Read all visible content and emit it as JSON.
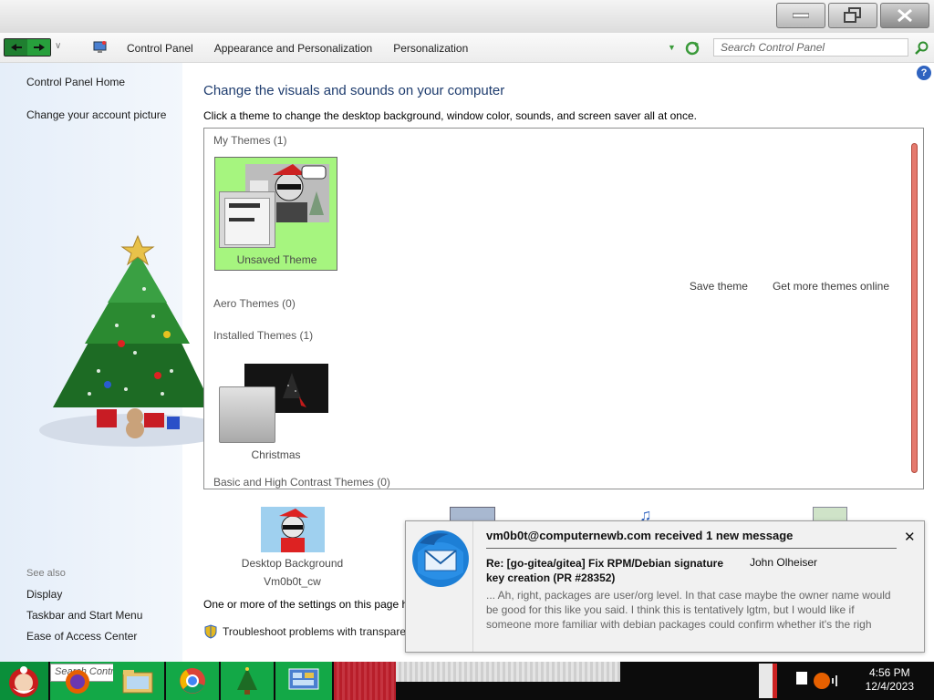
{
  "window": {
    "buttons": {
      "minimize": "minimize",
      "restore": "restore",
      "close": "close"
    }
  },
  "nav": {
    "breadcrumbs": [
      "Control Panel",
      "Appearance and Personalization",
      "Personalization"
    ],
    "search_placeholder": "Search Control Panel"
  },
  "sidebar": {
    "links": [
      "Control Panel Home",
      "Change your account picture"
    ],
    "see_also_heading": "See also",
    "see_also_links": [
      "Display",
      "Taskbar and Start Menu",
      "Ease of Access Center"
    ]
  },
  "main": {
    "title": "Change the visuals and sounds on your computer",
    "subtitle": "Click a theme to change the desktop background, window color, sounds, and screen saver all at once.",
    "groups": {
      "my_themes": "My Themes (1)",
      "aero_themes": "Aero Themes (0)",
      "installed_themes": "Installed Themes (1)",
      "basic_themes": "Basic and High Contrast Themes (0)"
    },
    "themes": {
      "unsaved": "Unsaved Theme",
      "christmas": "Christmas"
    },
    "actions": {
      "save": "Save theme",
      "get_more": "Get more themes online"
    },
    "settings": {
      "desktop_background_label": "Desktop Background",
      "desktop_background_value": "Vm0b0t_cw"
    },
    "message": "One or more of the settings on this page h",
    "troubleshoot": "Troubleshoot problems with transpare"
  },
  "notification": {
    "title": "vm0b0t@computernewb.com received 1 new message",
    "subject": "Re: [go-gitea/gitea] Fix RPM/Debian signature key creation (PR #28352)",
    "from": "John Olheiser",
    "body": "... Ah, right, packages are user/org level. In that case maybe the owner name would be good for this like you said. I think this is tentatively lgtm, but I would like if someone more familiar with debian packages could confirm whether it's the righ"
  },
  "taskbar": {
    "search_placeholder": "Search Contro",
    "time": "4:56 PM",
    "date": "12/4/2023"
  },
  "colors": {
    "selected_theme_bg": "#a6f57f",
    "taskbar_green": "#13a847",
    "title_blue": "#1e3c6e"
  }
}
